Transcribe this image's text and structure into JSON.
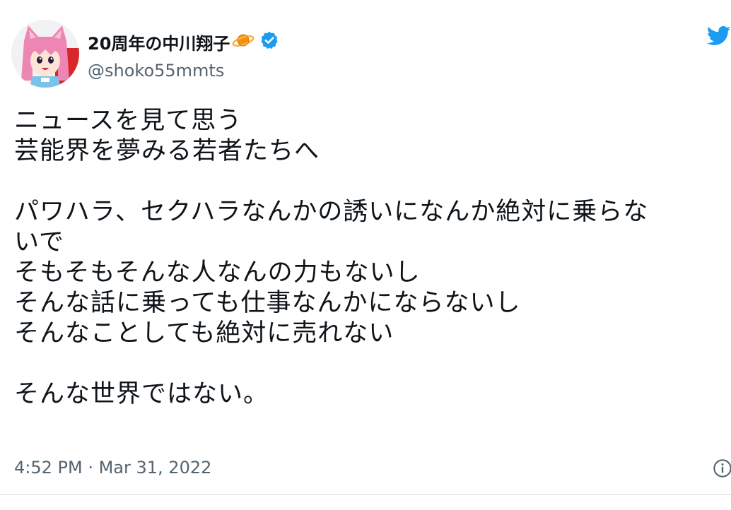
{
  "tweet": {
    "display_name": "20周年の中川翔子",
    "handle": "@shoko55mmts",
    "lines": [
      "ニュースを見て思う",
      "芸能界を夢みる若者たちへ",
      "",
      "パワハラ、セクハラなんかの誘いになんか絶対に乗らな",
      "いで",
      "そもそもそんな人なんの力もないし",
      "そんな話に乗っても仕事なんかにならないし",
      "そんなことしても絶対に売れない",
      "",
      "そんな世界ではない。"
    ],
    "timestamp": "4:52 PM · Mar 31, 2022"
  },
  "colors": {
    "text_primary": "#0f1419",
    "text_secondary": "#536471",
    "twitter_blue": "#1d9bf0",
    "planet_orange": "#f4900c"
  },
  "icons": {
    "avatar": "anime-cat-girl-avatar",
    "planet": "ringed-planet-emoji",
    "verified": "verified-badge-icon",
    "brand": "twitter-bird-icon",
    "info": "info-icon"
  }
}
